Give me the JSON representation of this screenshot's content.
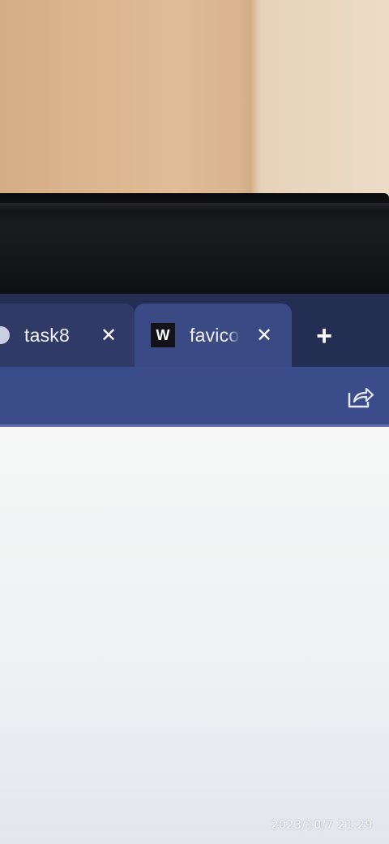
{
  "browser": {
    "tabs": [
      {
        "label": "task8",
        "close_label": "✕",
        "active": false
      },
      {
        "favicon_text": "W",
        "label": "favico",
        "close_label": "✕",
        "active": true
      }
    ],
    "new_tab_label": "+",
    "share_icon": "share-icon"
  },
  "photo": {
    "timestamp": "2023/10/7 21:29"
  },
  "colors": {
    "tabstrip": "#242d52",
    "active_tab": "#3a4a85",
    "toolbar": "#3b4c8a",
    "page": "#f3f4f6"
  }
}
